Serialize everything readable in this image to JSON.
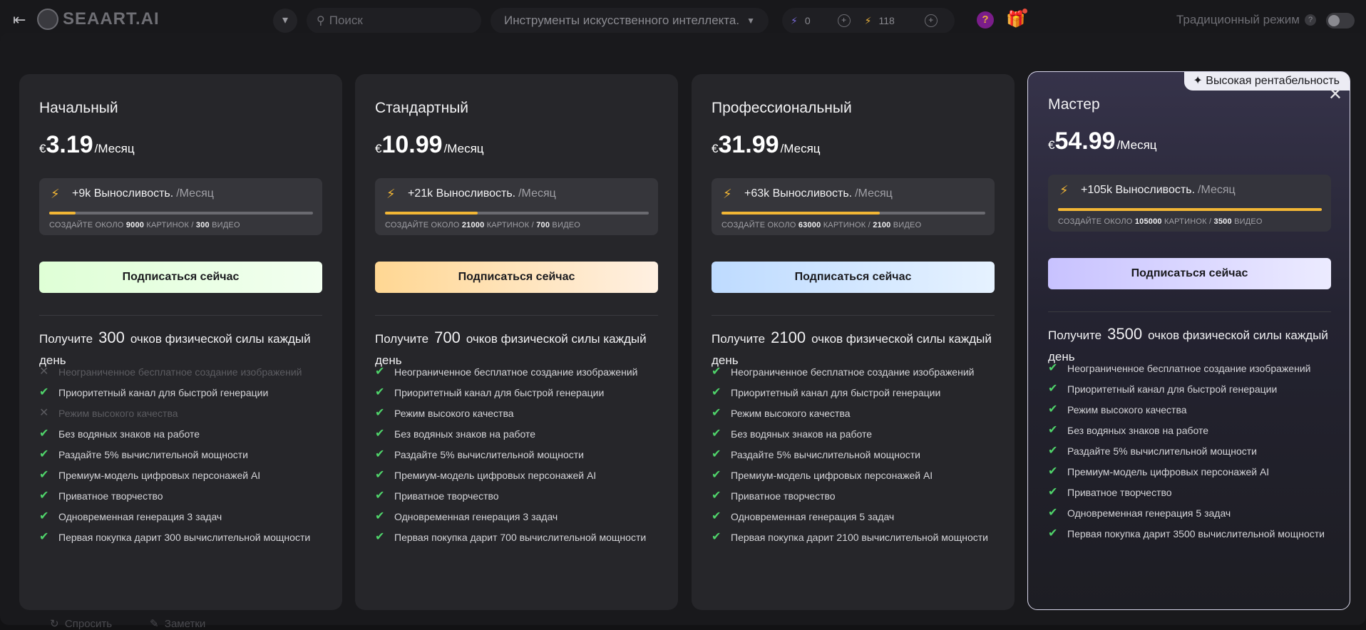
{
  "header": {
    "logo_text": "SEAART.AI",
    "search_placeholder": "Поиск",
    "tools_label": "Инструменты искусственного интеллекта.",
    "credits_a": "0",
    "credits_b": "118",
    "help_label": "?",
    "mode_label": "Традиционный режим",
    "mode_help": "?"
  },
  "modal": {
    "badge": "Высокая рентабельность",
    "subscribe_label": "Подписаться сейчас",
    "price_suffix": "/Месяц",
    "stamina_word": "Выносливость.",
    "create_prefix": "СОЗДАЙТЕ ОКОЛО",
    "pictures_word": "КАРТИНОК",
    "video_word": "ВИДЕО",
    "daily_prefix": "Получите",
    "daily_suffix": "очков физической силы каждый день",
    "plans": [
      {
        "name": "Начальный",
        "currency": "€",
        "price": "3.19",
        "stamina": "+9k",
        "images": "9000",
        "videos": "300",
        "stamina_fill": 0.1,
        "daily": "300",
        "features": [
          {
            "text": "Неограниченное бесплатное создание изображений",
            "included": false
          },
          {
            "text": "Приоритетный канал для быстрой генерации",
            "included": true
          },
          {
            "text": "Режим высокого качества",
            "included": false
          },
          {
            "text": "Без водяных знаков на работе",
            "included": true
          },
          {
            "text": "Раздайте 5% вычислительной мощности",
            "included": true
          },
          {
            "text": "Премиум-модель цифровых персонажей AI",
            "included": true
          },
          {
            "text": "Приватное творчество",
            "included": true
          },
          {
            "text": "Одновременная генерация 3 задач",
            "included": true
          },
          {
            "text": "Первая покупка дарит 300 вычислительной мощности",
            "included": true
          }
        ]
      },
      {
        "name": "Стандартный",
        "currency": "€",
        "price": "10.99",
        "stamina": "+21k",
        "images": "21000",
        "videos": "700",
        "stamina_fill": 0.35,
        "daily": "700",
        "features": [
          {
            "text": "Неограниченное бесплатное создание изображений",
            "included": true
          },
          {
            "text": "Приоритетный канал для быстрой генерации",
            "included": true
          },
          {
            "text": "Режим высокого качества",
            "included": true
          },
          {
            "text": "Без водяных знаков на работе",
            "included": true
          },
          {
            "text": "Раздайте 5% вычислительной мощности",
            "included": true
          },
          {
            "text": "Премиум-модель цифровых персонажей AI",
            "included": true
          },
          {
            "text": "Приватное творчество",
            "included": true
          },
          {
            "text": "Одновременная генерация 3 задач",
            "included": true
          },
          {
            "text": "Первая покупка дарит 700 вычислительной мощности",
            "included": true
          }
        ]
      },
      {
        "name": "Профессиональный",
        "currency": "€",
        "price": "31.99",
        "stamina": "+63k",
        "images": "63000",
        "videos": "2100",
        "stamina_fill": 0.6,
        "daily": "2100",
        "features": [
          {
            "text": "Неограниченное бесплатное создание изображений",
            "included": true
          },
          {
            "text": "Приоритетный канал для быстрой генерации",
            "included": true
          },
          {
            "text": "Режим высокого качества",
            "included": true
          },
          {
            "text": "Без водяных знаков на работе",
            "included": true
          },
          {
            "text": "Раздайте 5% вычислительной мощности",
            "included": true
          },
          {
            "text": "Премиум-модель цифровых персонажей AI",
            "included": true
          },
          {
            "text": "Приватное творчество",
            "included": true
          },
          {
            "text": "Одновременная генерация 5 задач",
            "included": true
          },
          {
            "text": "Первая покупка дарит 2100 вычислительной мощности",
            "included": true
          }
        ]
      },
      {
        "name": "Мастер",
        "currency": "€",
        "price": "54.99",
        "stamina": "+105k",
        "images": "105000",
        "videos": "3500",
        "stamina_fill": 1.0,
        "daily": "3500",
        "features": [
          {
            "text": "Неограниченное бесплатное создание изображений",
            "included": true
          },
          {
            "text": "Приоритетный канал для быстрой генерации",
            "included": true
          },
          {
            "text": "Режим высокого качества",
            "included": true
          },
          {
            "text": "Без водяных знаков на работе",
            "included": true
          },
          {
            "text": "Раздайте 5% вычислительной мощности",
            "included": true
          },
          {
            "text": "Премиум-модель цифровых персонажей AI",
            "included": true
          },
          {
            "text": "Приватное творчество",
            "included": true
          },
          {
            "text": "Одновременная генерация 5 задач",
            "included": true
          },
          {
            "text": "Первая покупка дарит 3500 вычислительной мощности",
            "included": true
          }
        ]
      }
    ]
  },
  "colors": {
    "accent_stamina": "#f2b635",
    "check_green": "#4fd36a",
    "card_bg": "#26262a",
    "page_bg": "#121214"
  },
  "icons": {
    "back": "arrow-left-bar-icon",
    "logo": "seaart-logo-icon",
    "filter": "filter-icon",
    "search": "search-icon",
    "credit_a": "lightning-purple-icon",
    "credit_b": "lightning-yellow-icon",
    "gift": "gift-icon",
    "close": "close-icon",
    "sparkle": "sparkle-icon",
    "check": "check-icon",
    "cross": "cross-icon"
  }
}
